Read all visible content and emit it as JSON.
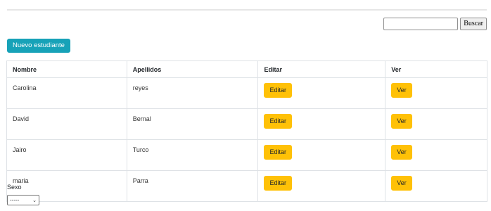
{
  "search": {
    "placeholder": "",
    "value": "",
    "button_label": "Buscar"
  },
  "actions": {
    "new_student_label": "Nuevo estudiante"
  },
  "table": {
    "headers": [
      "Nombre",
      "Apellidos",
      "Editar",
      "Ver"
    ],
    "rows": [
      {
        "nombre": "Carolina",
        "apellidos": "reyes",
        "edit_label": "Editar",
        "view_label": "Ver"
      },
      {
        "nombre": "David",
        "apellidos": "Bernal",
        "edit_label": "Editar",
        "view_label": "Ver"
      },
      {
        "nombre": "Jairo",
        "apellidos": "Turco",
        "edit_label": "Editar",
        "view_label": "Ver"
      },
      {
        "nombre": "maria",
        "apellidos": "Parra",
        "edit_label": "Editar",
        "view_label": "Ver"
      }
    ]
  },
  "filter": {
    "label": "Sexo",
    "selected": "-----"
  },
  "colors": {
    "primary_info": "#17a2b8",
    "warning": "#ffc107",
    "border": "#dee2e6"
  }
}
